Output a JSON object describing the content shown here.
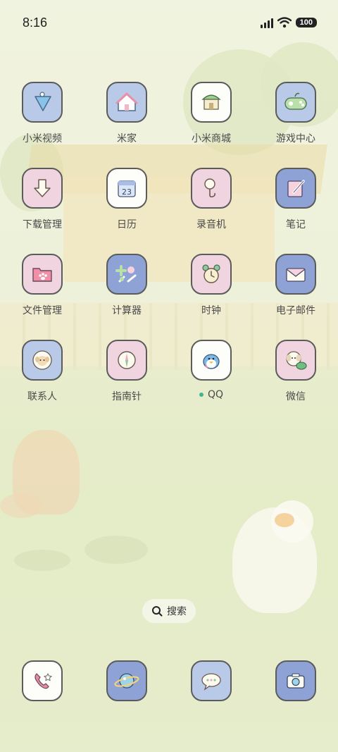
{
  "status_bar": {
    "time": "8:16",
    "battery": "100"
  },
  "apps": [
    [
      {
        "label": "小米视频",
        "icon": "video-icon",
        "bg": "blue"
      },
      {
        "label": "米家",
        "icon": "home-icon",
        "bg": "blue"
      },
      {
        "label": "小米商城",
        "icon": "shop-icon",
        "bg": "white"
      },
      {
        "label": "游戏中心",
        "icon": "gamepad-icon",
        "bg": "blue"
      }
    ],
    [
      {
        "label": "下载管理",
        "icon": "download-icon",
        "bg": "pink"
      },
      {
        "label": "日历",
        "icon": "calendar-icon",
        "bg": "white",
        "day": "23"
      },
      {
        "label": "录音机",
        "icon": "microphone-icon",
        "bg": "pink"
      },
      {
        "label": "笔记",
        "icon": "notes-icon",
        "bg": "navy"
      }
    ],
    [
      {
        "label": "文件管理",
        "icon": "folder-icon",
        "bg": "pink"
      },
      {
        "label": "计算器",
        "icon": "calculator-icon",
        "bg": "navy"
      },
      {
        "label": "时钟",
        "icon": "clock-icon",
        "bg": "pink"
      },
      {
        "label": "电子邮件",
        "icon": "mail-icon",
        "bg": "navy"
      }
    ],
    [
      {
        "label": "联系人",
        "icon": "contacts-icon",
        "bg": "blue"
      },
      {
        "label": "指南针",
        "icon": "compass-icon",
        "bg": "pink"
      },
      {
        "label": "QQ",
        "icon": "qq-icon",
        "bg": "white"
      },
      {
        "label": "微信",
        "icon": "wechat-icon",
        "bg": "pink"
      }
    ]
  ],
  "search": {
    "label": "搜索",
    "icon": "search-icon"
  },
  "dock": [
    {
      "icon": "phone-icon",
      "bg": "white"
    },
    {
      "icon": "browser-icon",
      "bg": "navy"
    },
    {
      "icon": "messages-icon",
      "bg": "blue"
    },
    {
      "icon": "camera-icon",
      "bg": "navy"
    }
  ],
  "colors": {
    "blue": "#b9c9e8",
    "pink": "#f0d4e0",
    "white": "#fdfdfa",
    "navy": "#8ea2d6",
    "notification_dot": "#3cb88e"
  }
}
